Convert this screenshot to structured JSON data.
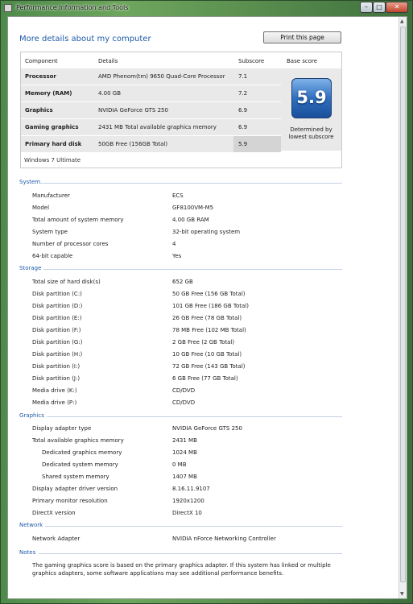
{
  "window": {
    "title": "Performance Information and Tools",
    "controls": {
      "minimize": "–",
      "maximize": "□",
      "close": "✕"
    }
  },
  "heading": "More details about my computer",
  "print_button": "Print this page",
  "score_table": {
    "headers": {
      "component": "Component",
      "details": "Details",
      "subscore": "Subscore",
      "base_score": "Base score"
    },
    "rows": [
      {
        "component": "Processor",
        "details": "AMD Phenom(tm) 9650 Quad-Core Processor",
        "subscore": "7.1"
      },
      {
        "component": "Memory (RAM)",
        "details": "4.00 GB",
        "subscore": "7.2"
      },
      {
        "component": "Graphics",
        "details": "NVIDIA GeForce GTS 250",
        "subscore": "6.9"
      },
      {
        "component": "Gaming graphics",
        "details": "2431 MB Total available graphics memory",
        "subscore": "6.9"
      },
      {
        "component": "Primary hard disk",
        "details": "50GB Free (156GB Total)",
        "subscore": "5.9"
      }
    ],
    "base_score": "5.9",
    "base_note_1": "Determined by",
    "base_note_2": "lowest subscore",
    "os": "Windows 7 Ultimate"
  },
  "sections": {
    "system": {
      "title": "System",
      "items": [
        {
          "label": "Manufacturer",
          "value": "ECS"
        },
        {
          "label": "Model",
          "value": "GF8100VM-M5"
        },
        {
          "label": "Total amount of system memory",
          "value": "4.00 GB RAM"
        },
        {
          "label": "System type",
          "value": "32-bit operating system"
        },
        {
          "label": "Number of processor cores",
          "value": "4"
        },
        {
          "label": "64-bit capable",
          "value": "Yes"
        }
      ]
    },
    "storage": {
      "title": "Storage",
      "items": [
        {
          "label": "Total size of hard disk(s)",
          "value": "652 GB"
        },
        {
          "label": "Disk partition (C:)",
          "value": "50 GB Free (156 GB Total)"
        },
        {
          "label": "Disk partition (D:)",
          "value": "101 GB Free (186 GB Total)"
        },
        {
          "label": "Disk partition (E:)",
          "value": "26 GB Free (78 GB Total)"
        },
        {
          "label": "Disk partition (F:)",
          "value": "78 MB Free (102 MB Total)"
        },
        {
          "label": "Disk partition (G:)",
          "value": "2 GB Free (2 GB Total)"
        },
        {
          "label": "Disk partition (H:)",
          "value": "10 GB Free (10 GB Total)"
        },
        {
          "label": "Disk partition (I:)",
          "value": "72 GB Free (143 GB Total)"
        },
        {
          "label": "Disk partition (J:)",
          "value": "6 GB Free (77 GB Total)"
        },
        {
          "label": "Media drive (K:)",
          "value": "CD/DVD"
        },
        {
          "label": "Media drive (P:)",
          "value": "CD/DVD"
        }
      ]
    },
    "graphics": {
      "title": "Graphics",
      "items": [
        {
          "label": "Display adapter type",
          "value": "NVIDIA GeForce GTS 250"
        },
        {
          "label": "Total available graphics memory",
          "value": "2431 MB"
        },
        {
          "label": "Dedicated graphics memory",
          "value": "1024 MB"
        },
        {
          "label": "Dedicated system memory",
          "value": "0 MB"
        },
        {
          "label": "Shared system memory",
          "value": "1407 MB"
        },
        {
          "label": "Display adapter driver version",
          "value": "8.16.11.9107"
        },
        {
          "label": "Primary monitor resolution",
          "value": "1920x1200"
        },
        {
          "label": "DirectX version",
          "value": "DirectX 10"
        }
      ]
    },
    "network": {
      "title": "Network",
      "items": [
        {
          "label": "Network Adapter",
          "value": "NVIDIA nForce Networking Controller"
        }
      ]
    },
    "notes": {
      "title": "Notes",
      "line1": "The gaming graphics score is based on the primary graphics adapter. If this system has linked or multiple",
      "line2": "graphics adapters, some software applications may see additional performance benefits."
    }
  }
}
